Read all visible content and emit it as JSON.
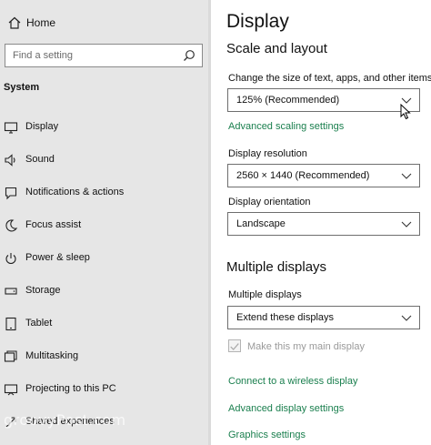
{
  "sidebar": {
    "home_label": "Home",
    "search_placeholder": "Find a setting",
    "section_title": "System",
    "items": [
      {
        "label": "Display",
        "icon": "monitor-icon"
      },
      {
        "label": "Sound",
        "icon": "speaker-icon"
      },
      {
        "label": "Notifications & actions",
        "icon": "notification-icon"
      },
      {
        "label": "Focus assist",
        "icon": "moon-icon"
      },
      {
        "label": "Power & sleep",
        "icon": "power-icon"
      },
      {
        "label": "Storage",
        "icon": "storage-icon"
      },
      {
        "label": "Tablet",
        "icon": "tablet-icon"
      },
      {
        "label": "Multitasking",
        "icon": "multitasking-icon"
      },
      {
        "label": "Projecting to this PC",
        "icon": "projector-icon"
      },
      {
        "label": "Shared experiences",
        "icon": "shared-icon"
      }
    ],
    "watermark": "groovyPost.com"
  },
  "main": {
    "title": "Display",
    "scale_heading": "Scale and layout",
    "scale_label": "Change the size of text, apps, and other items",
    "scale_value": "125% (Recommended)",
    "advanced_scaling_link": "Advanced scaling settings",
    "resolution_label": "Display resolution",
    "resolution_value": "2560 × 1440 (Recommended)",
    "orientation_label": "Display orientation",
    "orientation_value": "Landscape",
    "multi_heading": "Multiple displays",
    "multi_label": "Multiple displays",
    "multi_value": "Extend these displays",
    "main_display_checkbox": "Make this my main display",
    "main_display_checked": true,
    "wireless_link": "Connect to a wireless display",
    "advanced_display_link": "Advanced display settings",
    "graphics_link": "Graphics settings"
  },
  "colors": {
    "sidebar_bg": "#e6e6e6",
    "link": "#1a7f4e"
  }
}
